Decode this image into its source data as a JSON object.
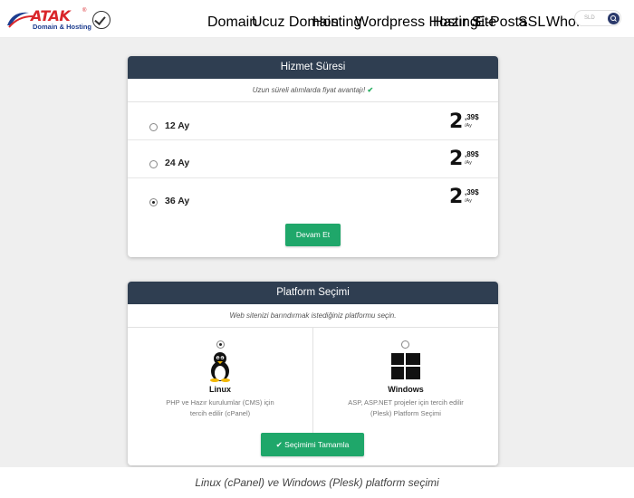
{
  "brand": {
    "name": "ATAK",
    "reg_mark": "®",
    "tagline": "Domain & Hosting"
  },
  "nav": {
    "items": [
      {
        "label": "Domain",
        "dropdown": true
      },
      {
        "label": "Ucuz Domain",
        "dropdown": false
      },
      {
        "label": "Hosting",
        "dropdown": true
      },
      {
        "label": "Wordpress Hosting",
        "dropdown": false
      },
      {
        "label": "Hazır Site",
        "dropdown": false
      },
      {
        "label": "E-Posta",
        "dropdown": false
      },
      {
        "label": "SSL",
        "dropdown": true
      },
      {
        "label": "WhoIs",
        "dropdown": false
      }
    ],
    "search_placeholder": "SLD",
    "search_icon": "search-icon"
  },
  "service_card": {
    "title": "Hizmet Süresi",
    "subtitle": "Uzun süreli alımlarda fiyat avantajı!",
    "subtitle_icon": "check-icon",
    "terms": [
      {
        "label": "12 Ay",
        "price_int": "2",
        "price_dec": ",39$",
        "unit": "/Ay",
        "selected": false
      },
      {
        "label": "24 Ay",
        "price_int": "2",
        "price_dec": ",89$",
        "unit": "/Ay",
        "selected": false
      },
      {
        "label": "36 Ay",
        "price_int": "2",
        "price_dec": ",39$",
        "unit": "/Ay",
        "selected": true
      }
    ],
    "continue_label": "Devam Et"
  },
  "platform_card": {
    "title": "Platform Seçimi",
    "subtitle": "Web sitenizi barındırmak istediğiniz platformu seçin.",
    "options": [
      {
        "name": "Linux",
        "icon": "tux-icon",
        "desc1": "PHP ve Hazır kurulumlar (CMS) için",
        "desc2": "tercih edilir (cPanel)",
        "selected": true
      },
      {
        "name": "Windows",
        "icon": "windows-logo-icon",
        "desc1": "ASP, ASP.NET projeler için tercih edilir",
        "desc2": "(Plesk) Platform Seçimi",
        "selected": false
      }
    ],
    "complete_icon": "check-circle-icon",
    "complete_label": "Seçimimi Tamamla"
  },
  "caption": "Linux (cPanel) ve Windows (Plesk) platform seçimi",
  "colors": {
    "header": "#2f3e51",
    "accent_green": "#1fa76a",
    "brand_red": "#d9262b",
    "brand_blue": "#1d3d8f"
  }
}
